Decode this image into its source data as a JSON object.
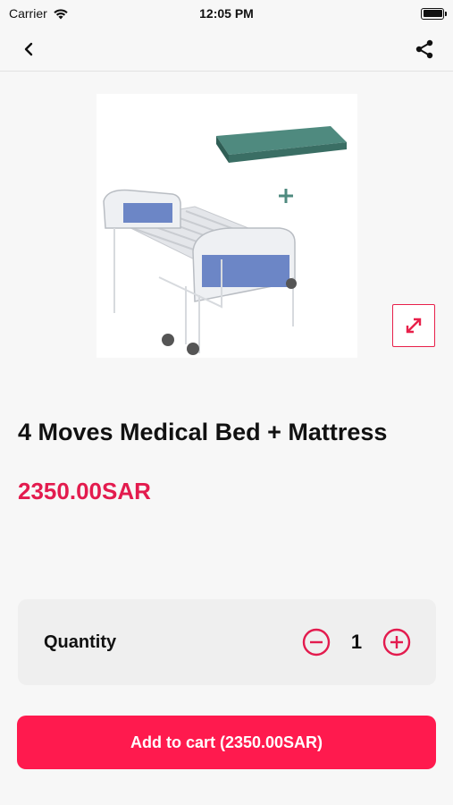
{
  "status_bar": {
    "carrier": "Carrier",
    "time": "12:05 PM"
  },
  "nav": {
    "back_icon": "back-chevron-icon",
    "share_icon": "share-icon"
  },
  "product": {
    "image_description": "medical bed with mattress product photo",
    "title": "4 Moves Medical Bed + Mattress",
    "price": "2350.00SAR"
  },
  "quantity": {
    "label": "Quantity",
    "value": "1"
  },
  "cart_button": {
    "label": "Add to cart (2350.00SAR)"
  },
  "colors": {
    "accent": "#e31b4e",
    "button": "#ff1a4e"
  }
}
